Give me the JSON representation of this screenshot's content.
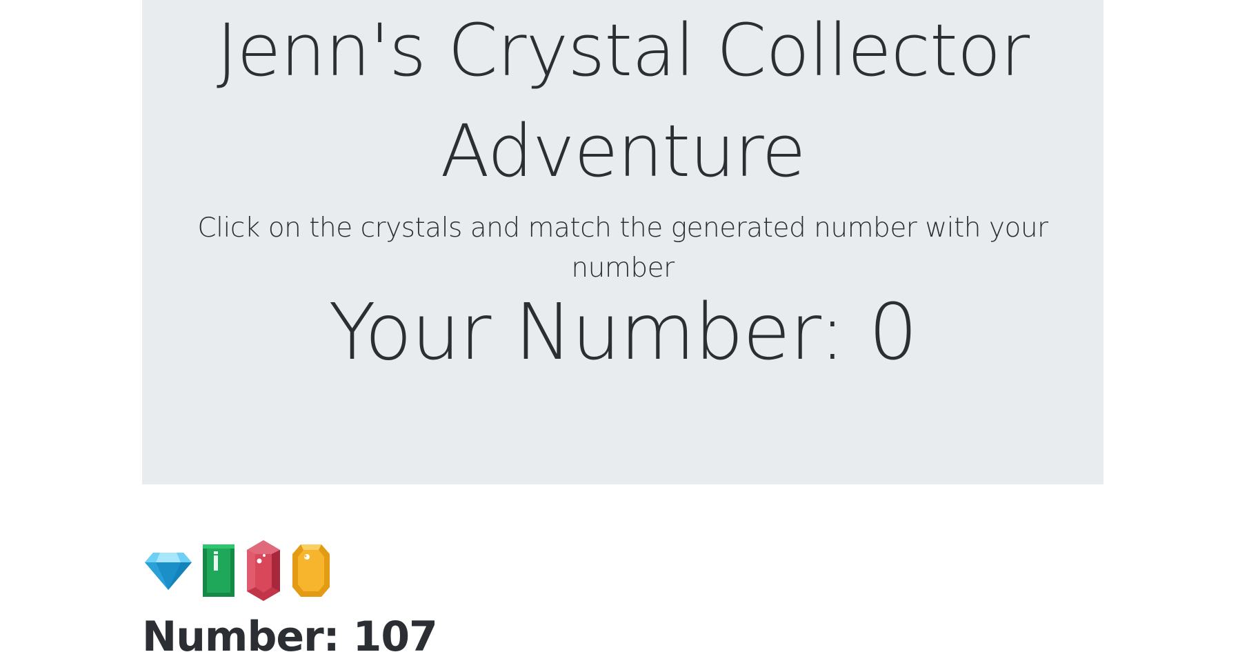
{
  "header": {
    "title_line1": "Jenn's Crystal Collector",
    "title_line2": "Adventure",
    "subtitle": "Click on the crystals and match the generated number with your number",
    "your_number_label": "Your Number: 0"
  },
  "crystals": [
    {
      "icon": "blue-diamond-icon",
      "color": "#29abe2"
    },
    {
      "icon": "green-emerald-icon",
      "color": "#1fa85a"
    },
    {
      "icon": "red-ruby-icon",
      "color": "#d9475b"
    },
    {
      "icon": "yellow-topaz-icon",
      "color": "#f6b52c"
    }
  ],
  "target": {
    "label": "Number: 107"
  },
  "colors": {
    "jumbotron_bg": "#e9ecef",
    "text": "#2b2f33"
  }
}
